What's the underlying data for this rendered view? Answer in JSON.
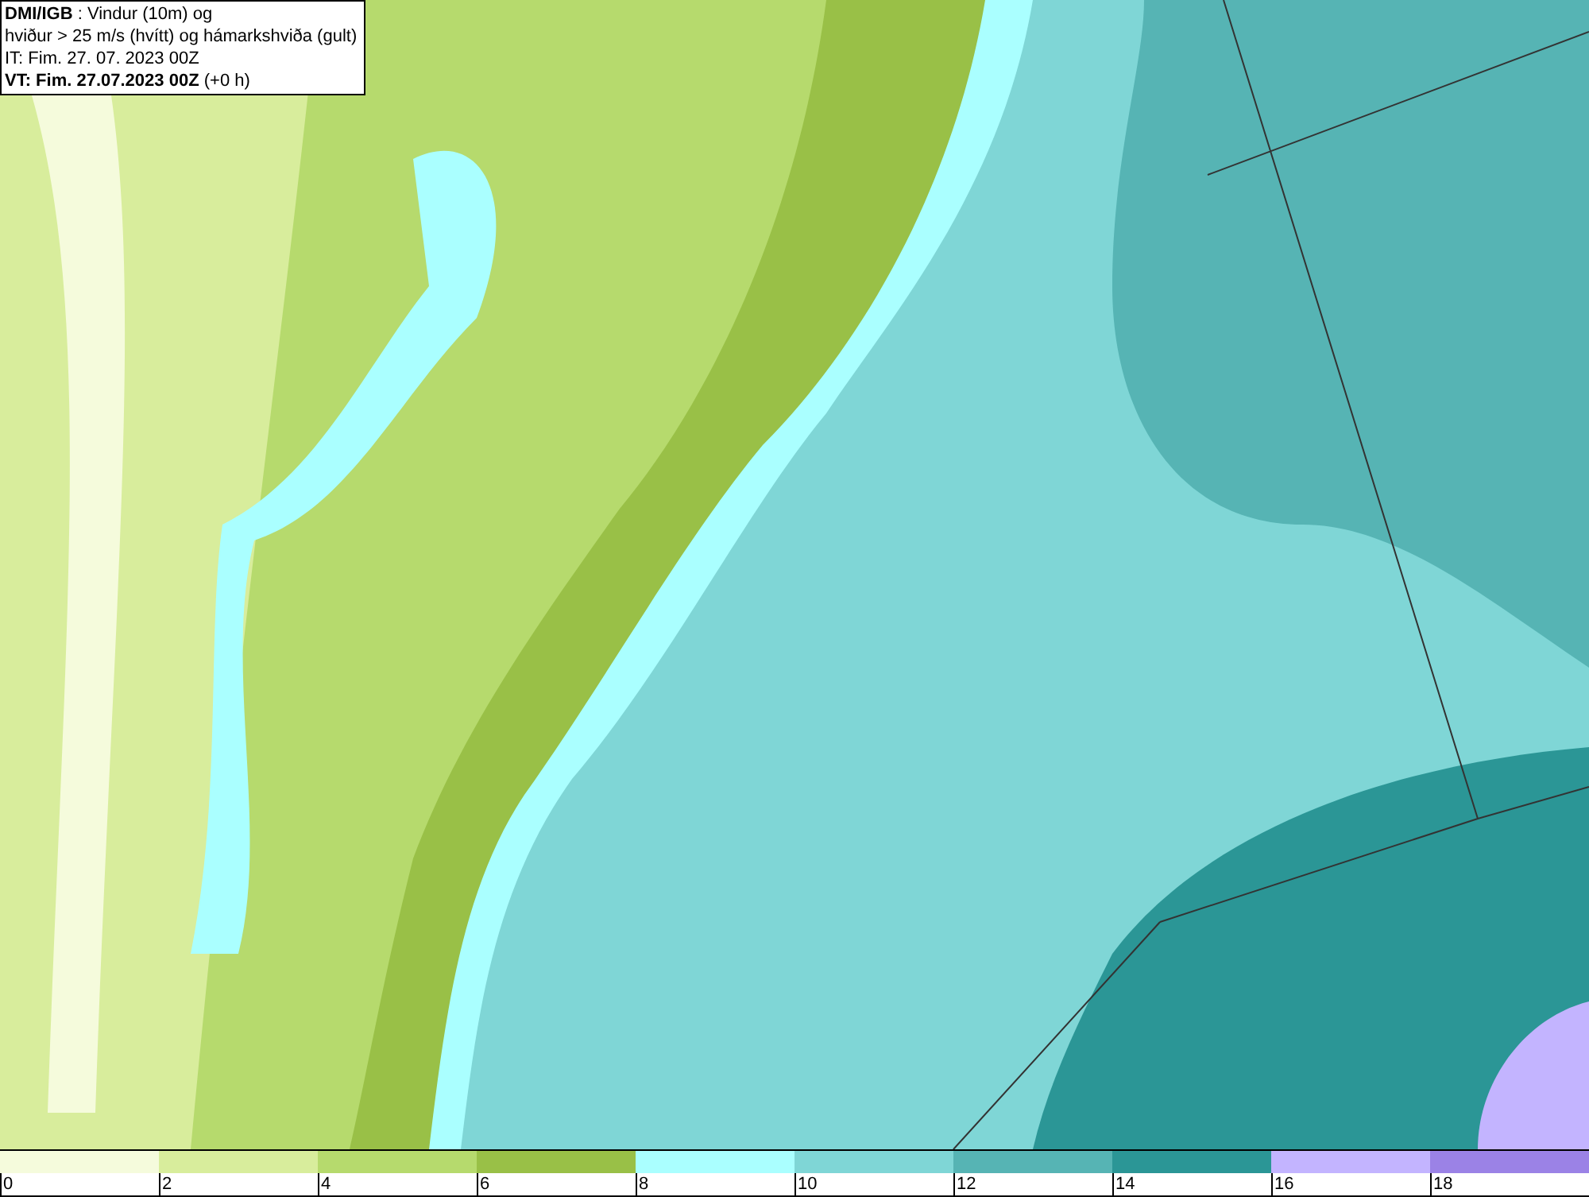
{
  "info_box": {
    "lines": [
      "**DMI/IGB** : Vindur (10m) og",
      "hviður > 25 m/s (hvítt) og hámarkshviða (gult)",
      "IT: Fim. 27. 07. 2023 00Z",
      "**VT: Fim. 27.07.2023 00Z** (+0 h)"
    ]
  },
  "legend": [
    {
      "label": "0",
      "color": "#f5fbdc"
    },
    {
      "label": "2",
      "color": "#d8ed9c"
    },
    {
      "label": "4",
      "color": "#b6da6d"
    },
    {
      "label": "6",
      "color": "#99c047"
    },
    {
      "label": "8",
      "color": "#aaffff"
    },
    {
      "label": "10",
      "color": "#7fd6d6"
    },
    {
      "label": "12",
      "color": "#56b4b4"
    },
    {
      "label": "14",
      "color": "#2b9696"
    },
    {
      "label": "16",
      "color": "#c3b4ff"
    },
    {
      "label": "18",
      "color": "#9b82e6"
    }
  ]
}
